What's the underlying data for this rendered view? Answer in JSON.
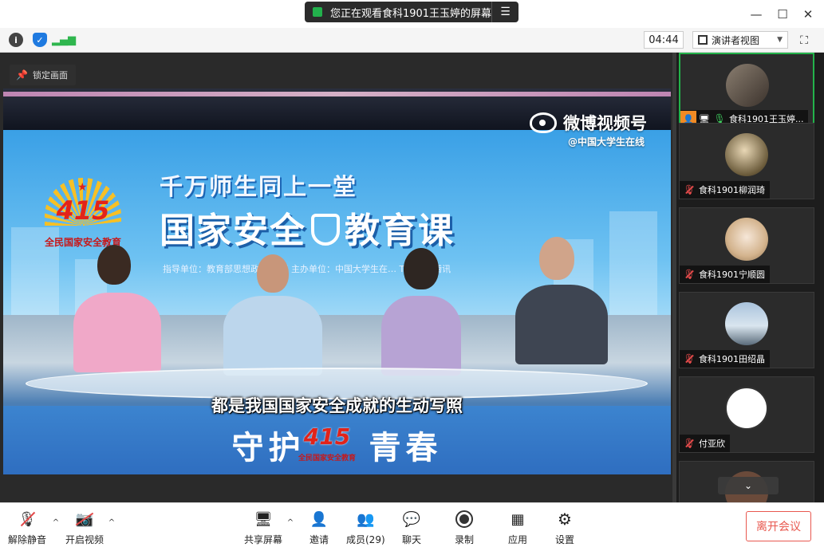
{
  "titlebar": {
    "share_text": "您正在观看食科1901王玉婷的屏幕",
    "menu_icon": "list-icon"
  },
  "subbar": {
    "timer": "04:44",
    "view_mode": "演讲者视图"
  },
  "stage": {
    "lock_label": "锁定画面",
    "video": {
      "weibo_brand": "微博视频号",
      "weibo_handle": "@中国大学生在线",
      "logo_number": "415",
      "logo_caption": "全民国家安全教育",
      "headline_line1": "千万师生同上一堂",
      "headline_part1": "国家安全",
      "headline_part2": "教育课",
      "sponsor_line": "指导单位：教育部思想政… 公司    主办单位：中国大学生在… Tencent腾讯",
      "subtitle": "都是我国国家安全成就的生动写照",
      "banner_left": "守护",
      "banner_right": "青春",
      "banner_logo_number": "415",
      "banner_logo_caption": "全民国家安全教育"
    }
  },
  "participants": [
    {
      "name": "食科1901王玉婷...",
      "status": "sharing",
      "mic": "on"
    },
    {
      "name": "食科1901柳润琦",
      "mic": "muted"
    },
    {
      "name": "食科1901宁顺圆",
      "mic": "muted"
    },
    {
      "name": "食科1901田绍晶",
      "mic": "muted"
    },
    {
      "name": "付亚欣",
      "mic": "muted"
    }
  ],
  "bottombar": {
    "unmute": "解除静音",
    "start_video": "开启视频",
    "share_screen": "共享屏幕",
    "invite": "邀请",
    "members": "成员(29)",
    "chat": "聊天",
    "record": "录制",
    "apps": "应用",
    "settings": "设置",
    "leave": "离开会议"
  },
  "colors": {
    "accent_green": "#23b24a",
    "leave_red": "#e8584f",
    "muted_red": "#e24a4a"
  }
}
